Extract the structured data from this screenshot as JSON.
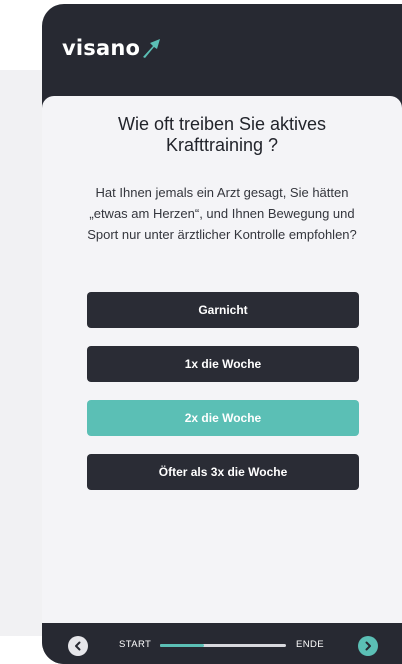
{
  "brand": {
    "name": "visano",
    "accent_color": "#5bbfb5",
    "dark_color": "#272932"
  },
  "question": {
    "title": "Wie oft treiben Sie aktives Krafttraining ?",
    "subtitle": "Hat Ihnen jemals ein Arzt gesagt, Sie hätten „etwas am Herzen“, und Ihnen Bewegung und Sport nur unter ärztlicher Kontrolle empfohlen?"
  },
  "options": [
    {
      "label": "Garnicht",
      "selected": false
    },
    {
      "label": "1x die Woche",
      "selected": false
    },
    {
      "label": "2x die Woche",
      "selected": true
    },
    {
      "label": "Öfter als 3x die Woche",
      "selected": false
    }
  ],
  "footer": {
    "back_icon": "chevron-left-icon",
    "next_icon": "chevron-right-icon",
    "start_label": "START",
    "end_label": "ENDE",
    "progress_fraction": 0.35
  }
}
